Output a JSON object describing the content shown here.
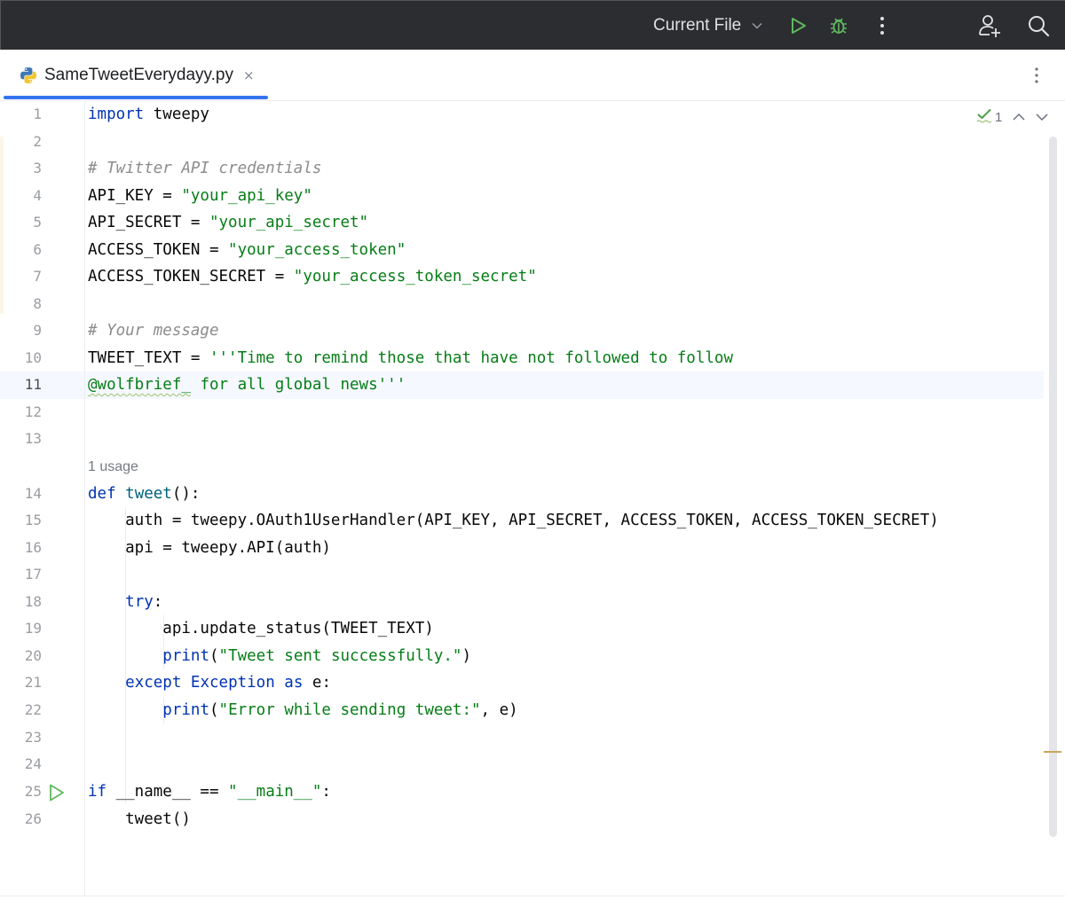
{
  "toolbar": {
    "run_config_label": "Current File",
    "icons": [
      "chevron-down-icon",
      "run-icon",
      "debug-icon",
      "more-vertical-icon",
      "add-user-icon",
      "search-icon"
    ],
    "run_color": "#5fb85f",
    "debug_color": "#5fb85f"
  },
  "tab": {
    "filename": "SameTweetEverydayy.py",
    "close_glyph": "×",
    "accent": "#3574f0"
  },
  "editor": {
    "usage_hint": "1 usage",
    "inspection_count": "1",
    "current_line": 11,
    "line_numbers": [
      "1",
      "2",
      "3",
      "4",
      "5",
      "6",
      "7",
      "8",
      "9",
      "10",
      "11",
      "12",
      "13",
      "14",
      "15",
      "16",
      "17",
      "18",
      "19",
      "20",
      "21",
      "22",
      "23",
      "24",
      "25",
      "26"
    ],
    "code": {
      "l1_kw": "import",
      "l1_rest": " tweepy",
      "l3_comment": "# Twitter API credentials",
      "l4_name": "API_KEY = ",
      "l4_str": "\"your_api_key\"",
      "l5_name": "API_SECRET = ",
      "l5_str": "\"your_api_secret\"",
      "l6_name": "ACCESS_TOKEN = ",
      "l6_str": "\"your_access_token\"",
      "l7_name": "ACCESS_TOKEN_SECRET = ",
      "l7_str": "\"your_access_token_secret\"",
      "l9_comment": "# Your message",
      "l10_name": "TWEET_TEXT = ",
      "l10_str": "'''Time to remind those that have not followed to follow",
      "l11_handle": "@wolfbrief_",
      "l11_str": " for all global news'''",
      "l14_kw": "def",
      "l14_fn": "tweet",
      "l14_rest": "():",
      "l15": "    auth = tweepy.OAuth1UserHandler(API_KEY, API_SECRET, ACCESS_TOKEN, ACCESS_TOKEN_SECRET)",
      "l16": "    api = tweepy.API(auth)",
      "l18_kw": "try",
      "l18_rest": ":",
      "l19": "        api.update_status(TWEET_TEXT)",
      "l20_fn": "print",
      "l20_open": "(",
      "l20_str": "\"Tweet sent successfully.\"",
      "l20_close": ")",
      "l21_kw1": "except",
      "l21_cls": "Exception",
      "l21_kw2": "as",
      "l21_rest": " e:",
      "l22_fn": "print",
      "l22_open": "(",
      "l22_str": "\"Error while sending tweet:\"",
      "l22_close": ", e)",
      "l25_kw": "if",
      "l25_mid": " __name__ == ",
      "l25_str": "\"__main__\"",
      "l25_rest": ":",
      "l26": "    tweet()"
    }
  }
}
